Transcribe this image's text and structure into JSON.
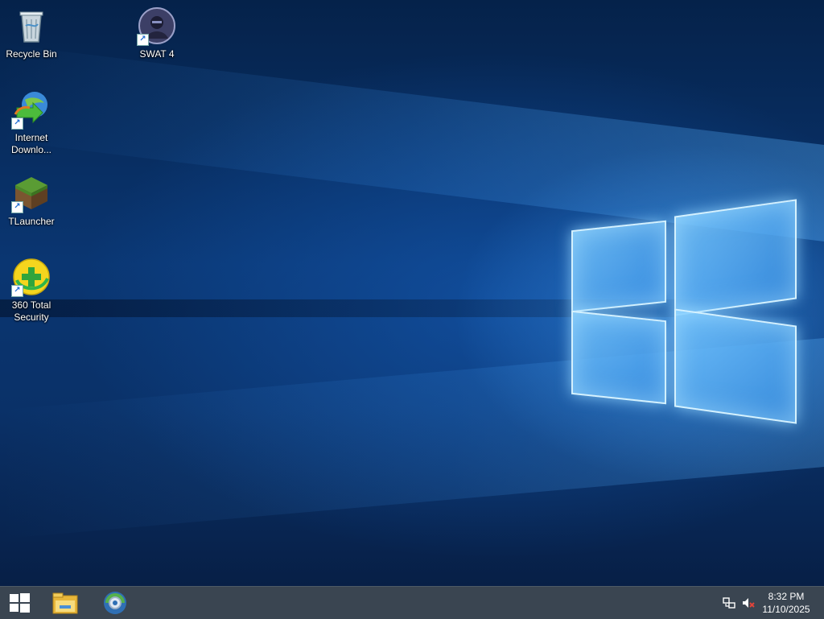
{
  "desktop": {
    "icons": [
      {
        "label": "Recycle Bin",
        "icon": "recycle-bin-icon"
      },
      {
        "label": "SWAT 4",
        "icon": "swat4-icon"
      },
      {
        "label": "Internet Downlo...",
        "icon": "internet-download-manager-icon"
      },
      {
        "label": "TLauncher",
        "icon": "tlauncher-icon"
      },
      {
        "label": "360 Total Security",
        "icon": "360-total-security-icon"
      }
    ]
  },
  "taskbar": {
    "start_icon": "windows-start-icon",
    "pinned": [
      {
        "icon": "file-explorer-icon"
      },
      {
        "icon": "browser-icon"
      }
    ],
    "tray": {
      "network_icon": "network-icon",
      "volume_icon": "volume-muted-icon"
    },
    "clock": {
      "time": "8:32 PM",
      "date": "11/10/2025"
    }
  },
  "colors": {
    "taskbar": "#3a4551",
    "accent": "#1e88ff",
    "wallpaper_dark": "#05224a"
  }
}
